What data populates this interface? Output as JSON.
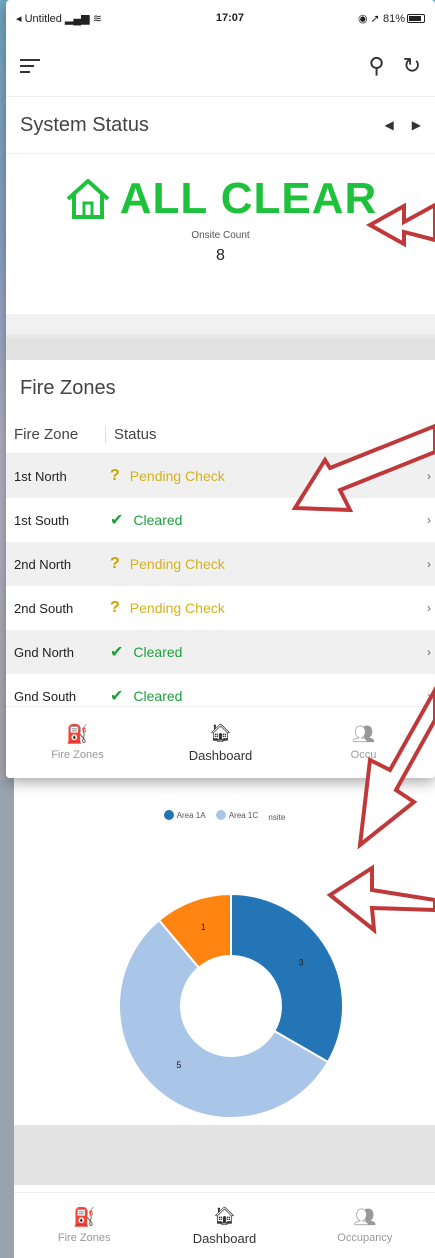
{
  "statusbar": {
    "carrier": "◂ Untitled",
    "time": "17:07",
    "battery": "81%"
  },
  "system_status": {
    "title": "System Status",
    "state_text": "ALL CLEAR",
    "onsite_label": "Onsite Count",
    "onsite_value": "8"
  },
  "fire_zones": {
    "title": "Fire Zones",
    "col_zone": "Fire Zone",
    "col_status": "Status",
    "rows": [
      {
        "zone": "1st North",
        "status": "Pending Check",
        "state": "pending"
      },
      {
        "zone": "1st South",
        "status": "Cleared",
        "state": "cleared"
      },
      {
        "zone": "2nd North",
        "status": "Pending Check",
        "state": "pending"
      },
      {
        "zone": "2nd South",
        "status": "Pending Check",
        "state": "pending"
      },
      {
        "zone": "Gnd North",
        "status": "Cleared",
        "state": "cleared"
      },
      {
        "zone": "Gnd South",
        "status": "Cleared",
        "state": "cleared"
      }
    ]
  },
  "nav": {
    "fire_zones": "Fire Zones",
    "dashboard": "Dashboard",
    "occupancy_top": "Occu",
    "occupancy": "Occupancy"
  },
  "legend": {
    "area1a": "Area 1A",
    "area1c": "Area 1C",
    "onsite": "nsite"
  },
  "colors": {
    "clear_green": "#1ec13c",
    "pending_yellow": "#d4b21d",
    "area1a": "#2375b5",
    "area1c": "#a9c5e8",
    "other": "#ff8412",
    "arrow": "#c0393a"
  },
  "chart_data": {
    "type": "pie",
    "categories": [
      "Area 1A",
      "Area 1C",
      "nsite"
    ],
    "values": [
      3,
      5,
      1
    ],
    "donut": true
  }
}
